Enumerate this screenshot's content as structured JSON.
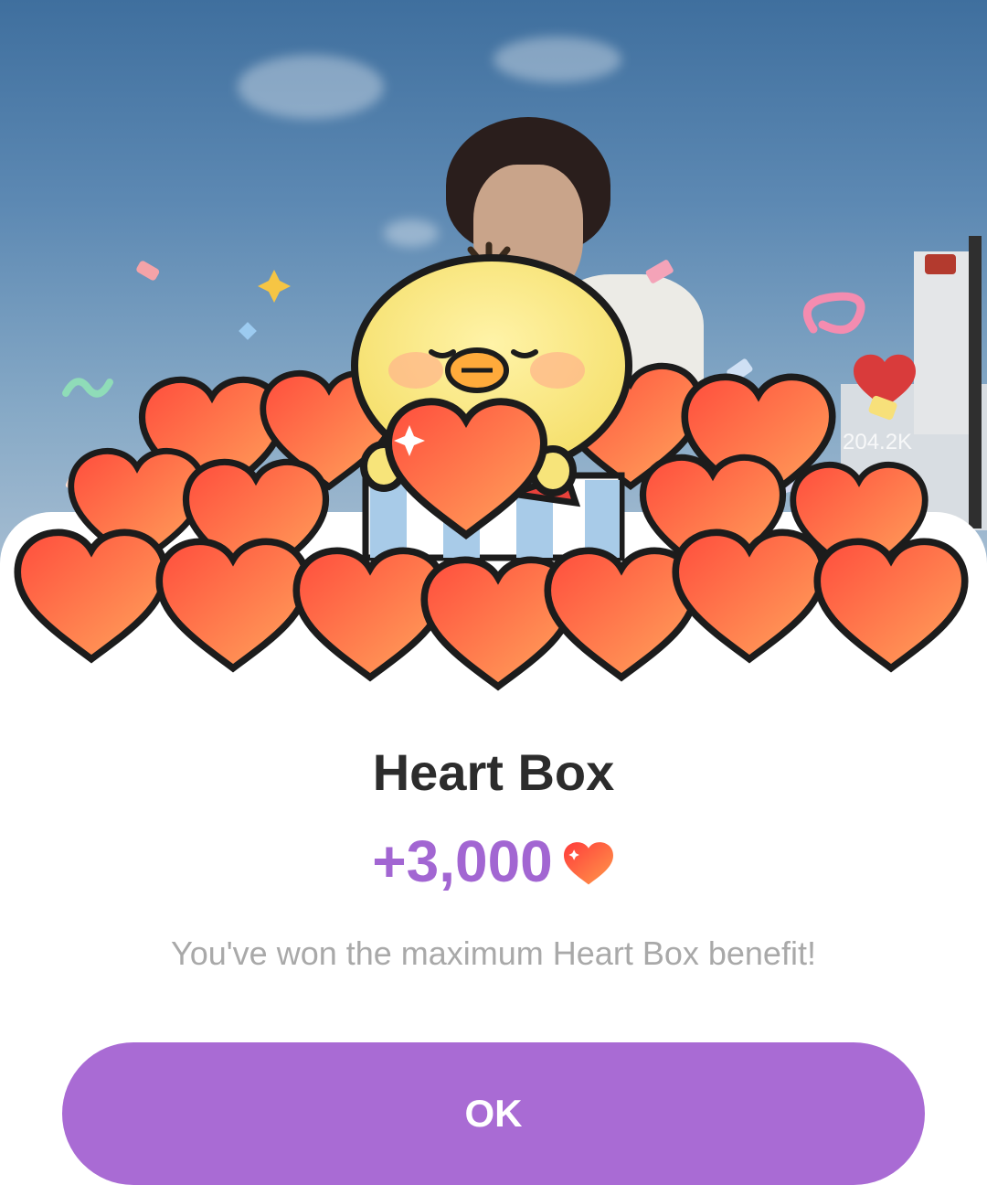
{
  "background": {
    "viewer_count": "204.2K"
  },
  "dialog": {
    "title": "Heart Box",
    "reward_amount": "+3,000",
    "reward_icon": "heart-icon",
    "message": "You've won the maximum Heart Box benefit!",
    "ok_label": "OK"
  },
  "colors": {
    "accent": "#a96bd4",
    "reward_text": "#a266d2",
    "heart_fill": "#ff7a4a",
    "title_text": "#2c2c2c",
    "message_text": "#a9a9a9"
  }
}
